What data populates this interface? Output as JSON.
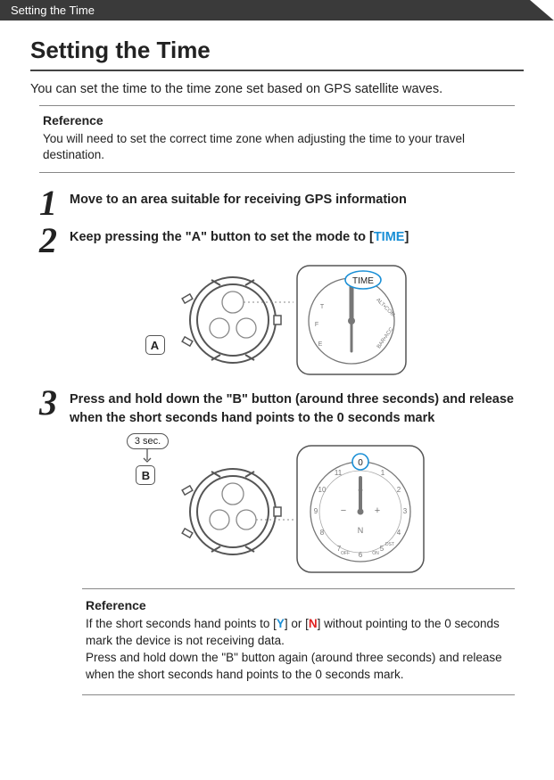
{
  "header": {
    "breadcrumb": "Setting the Time"
  },
  "title": "Setting the Time",
  "intro": "You can set the time to the time zone set based on GPS satellite waves.",
  "reference1": {
    "label": "Reference",
    "text": "You will need to set the correct time zone when adjusting the time to your travel destination."
  },
  "steps": {
    "s1": {
      "num": "1",
      "text": "Move to an area suitable for receiving GPS information"
    },
    "s2": {
      "num": "2",
      "text_prefix": "Keep pressing the \"A\" button to set the mode to [",
      "mode_word": "TIME",
      "text_suffix": "]"
    },
    "s3": {
      "num": "3",
      "text": "Press and hold down the \"B\" button (around three seconds) and release when the short seconds hand points to the 0 seconds mark"
    }
  },
  "illus": {
    "btnA": "A",
    "btnB": "B",
    "hold_label": "3 sec.",
    "mode_dial_text": "M  ALT•COM•BAR•ACC•  E  T  F",
    "seconds_dial_text": "0  1  2  3  4  ON  5  DST  6  OFF  7  8  9  10  11",
    "dial_marks": {
      "Y": "Y",
      "N": "N",
      "plus": "+",
      "minus": "−"
    },
    "zero_mark": "0",
    "time_badge": "TIME"
  },
  "reference2": {
    "label": "Reference",
    "line1a": "If the short seconds hand points to [",
    "Y": "Y",
    "line1b": "] or [",
    "N": "N",
    "line1c": "] without pointing to the 0 seconds mark the device is not receiving data.",
    "line2": "Press and hold down the \"B\" button again (around three seconds) and release when the short seconds hand points to the 0 seconds mark."
  }
}
